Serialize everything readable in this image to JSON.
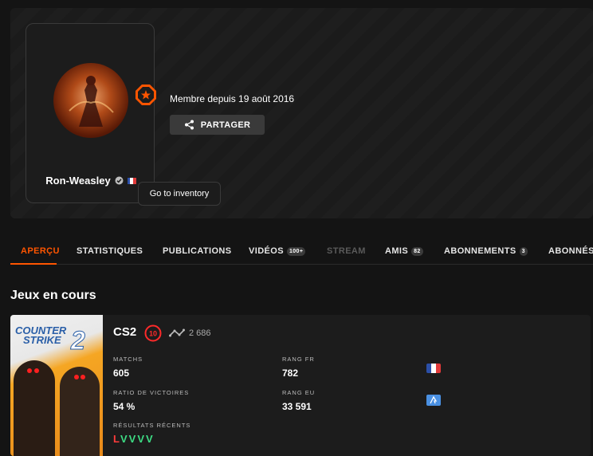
{
  "profile": {
    "nickname": "Ron-Weasley",
    "member_since": "Membre depuis 19 août 2016",
    "share_label": "PARTAGER",
    "tooltip": "Go to inventory",
    "accent_color": "#ff5500"
  },
  "tabs": [
    {
      "label": "APERÇU",
      "active": true
    },
    {
      "label": "STATISTIQUES"
    },
    {
      "label": "PUBLICATIONS"
    },
    {
      "label": "VIDÉOS",
      "count": "100+"
    },
    {
      "label": "STREAM",
      "disabled": true
    },
    {
      "label": "AMIS",
      "count": "82"
    },
    {
      "label": "ABONNEMENTS",
      "count": "3"
    },
    {
      "label": "ABONNÉS"
    }
  ],
  "section_title": "Jeux en cours",
  "game": {
    "cover_title_line1": "COUNTER",
    "cover_title_line2": "STRIKE",
    "cover_number": "2",
    "name": "CS2",
    "level": "10",
    "elo": "2 686",
    "matches_label": "MATCHS",
    "matches_value": "605",
    "rank_fr_label": "RANG FR",
    "rank_fr_value": "782",
    "winrate_label": "RATIO DE VICTOIRES",
    "winrate_value": "54 %",
    "rank_eu_label": "RANG EU",
    "rank_eu_value": "33 591",
    "results_label": "RÉSULTATS RÉCENTS",
    "results": [
      {
        "r": "L",
        "color": "#ff3b3b"
      },
      {
        "r": "V",
        "color": "#3ddc84"
      },
      {
        "r": "V",
        "color": "#3ddc84"
      },
      {
        "r": "V",
        "color": "#3ddc84"
      },
      {
        "r": "V",
        "color": "#3ddc84"
      }
    ]
  }
}
